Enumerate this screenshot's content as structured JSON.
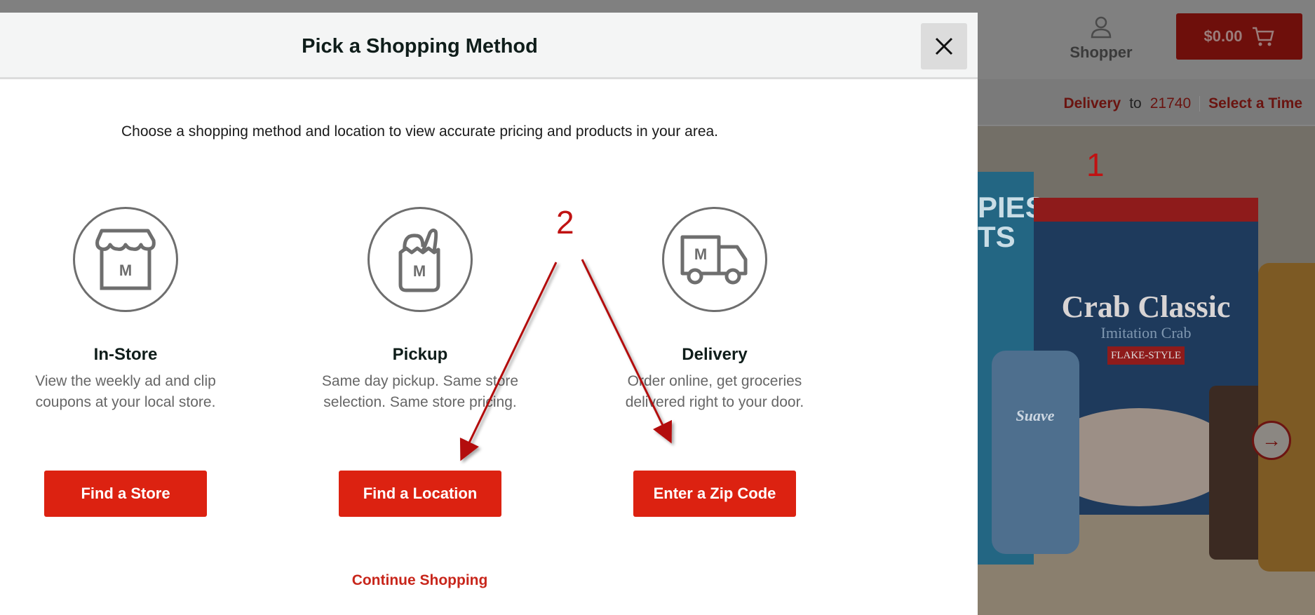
{
  "background_site": {
    "account": {
      "label": "Shopper",
      "icon": "user-icon"
    },
    "cart": {
      "total": "$0.00",
      "icon": "cart-icon"
    },
    "delivery_bar": {
      "method": "Delivery",
      "to": "to",
      "zip": "21740",
      "select_time": "Select a Time"
    },
    "hero": {
      "crab_title": "Crab Classic",
      "crab_subtitle": "Imitation Crab",
      "crab_flake": "FLAKE-STYLE",
      "cereal_text": "PIES\nTS",
      "deodorant_label": "Suave",
      "next_icon": "arrow-right-icon",
      "next_glyph": "→"
    }
  },
  "modal": {
    "title": "Pick a Shopping Method",
    "close_icon": "close-icon",
    "intro": "Choose a shopping method and location to view accurate pricing and products in your area.",
    "options": [
      {
        "id": "in-store",
        "icon": "storefront-icon",
        "title": "In-Store",
        "description": "View the weekly ad and clip coupons at your local store.",
        "button": "Find a Store"
      },
      {
        "id": "pickup",
        "icon": "grocery-bag-icon",
        "title": "Pickup",
        "description": "Same day pickup. Same store selection. Same store pricing.",
        "button": "Find a Location"
      },
      {
        "id": "delivery",
        "icon": "delivery-truck-icon",
        "title": "Delivery",
        "description": "Order online, get groceries delivered right to your door.",
        "button": "Enter a Zip Code"
      }
    ],
    "continue_link": "Continue Shopping",
    "icon_letter": "M"
  },
  "annotations": {
    "step1": "1",
    "step2": "2"
  },
  "colors": {
    "brand_red": "#dc2211",
    "link_red": "#c8261b",
    "annotation_red": "#c01212",
    "overlay_grey": "#808080",
    "icon_grey": "#6e6e6e"
  }
}
